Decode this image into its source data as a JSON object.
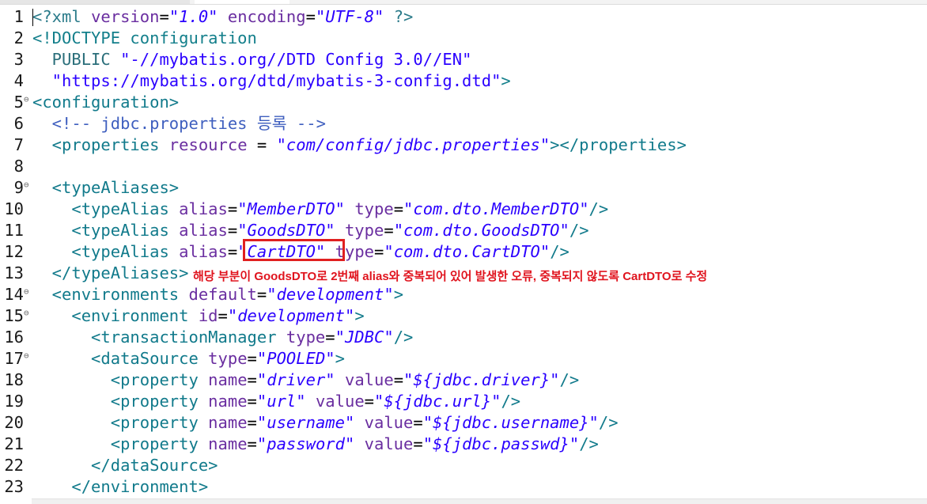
{
  "editor": {
    "lines": [
      {
        "num": "1",
        "fold": "",
        "segs": [
          [
            "pi",
            "<?xml "
          ],
          [
            "attr",
            "version"
          ],
          [
            "plain",
            "="
          ],
          [
            "str",
            "\"1.0\""
          ],
          [
            "plain",
            " "
          ],
          [
            "attr",
            "encoding"
          ],
          [
            "plain",
            "="
          ],
          [
            "str",
            "\"UTF-8\""
          ],
          [
            "plain",
            " "
          ],
          [
            "pi",
            "?>"
          ]
        ]
      },
      {
        "num": "2",
        "fold": "",
        "segs": [
          [
            "doct",
            "<!DOCTYPE configuration"
          ]
        ]
      },
      {
        "num": "3",
        "fold": "",
        "segs": [
          [
            "pub",
            "  PUBLIC "
          ],
          [
            "dstr",
            "\"-//mybatis.org//DTD Config 3.0//EN\""
          ]
        ]
      },
      {
        "num": "4",
        "fold": "",
        "segs": [
          [
            "dstr",
            "  \"https://mybatis.org/dtd/mybatis-3-config.dtd\""
          ],
          [
            "doct",
            ">"
          ]
        ]
      },
      {
        "num": "5",
        "fold": "⊖",
        "segs": [
          [
            "tag",
            "<configuration>"
          ]
        ]
      },
      {
        "num": "6",
        "fold": "",
        "segs": [
          [
            "comment",
            "  <!-- jdbc.properties 등록 -->"
          ]
        ]
      },
      {
        "num": "7",
        "fold": "",
        "segs": [
          [
            "tag",
            "  <properties "
          ],
          [
            "attr",
            "resource"
          ],
          [
            "plain",
            " = "
          ],
          [
            "str",
            "\"com/config/jdbc.properties\""
          ],
          [
            "tag",
            "></properties>"
          ]
        ]
      },
      {
        "num": "8",
        "fold": "",
        "segs": []
      },
      {
        "num": "9",
        "fold": "⊖",
        "segs": [
          [
            "tag",
            "  <typeAliases>"
          ]
        ]
      },
      {
        "num": "10",
        "fold": "",
        "segs": [
          [
            "tag",
            "    <typeAlias "
          ],
          [
            "attr",
            "alias"
          ],
          [
            "plain",
            "="
          ],
          [
            "str",
            "\"MemberDTO\""
          ],
          [
            "plain",
            " "
          ],
          [
            "attr",
            "type"
          ],
          [
            "plain",
            "="
          ],
          [
            "str",
            "\"com.dto.MemberDTO\""
          ],
          [
            "tag",
            "/>"
          ]
        ]
      },
      {
        "num": "11",
        "fold": "",
        "segs": [
          [
            "tag",
            "    <typeAlias "
          ],
          [
            "attr",
            "alias"
          ],
          [
            "plain",
            "="
          ],
          [
            "str",
            "\"GoodsDTO\""
          ],
          [
            "plain",
            " "
          ],
          [
            "attr",
            "type"
          ],
          [
            "plain",
            "="
          ],
          [
            "str",
            "\"com.dto.GoodsDTO\""
          ],
          [
            "tag",
            "/>"
          ]
        ]
      },
      {
        "num": "12",
        "fold": "",
        "segs": [
          [
            "tag",
            "    <typeAlias "
          ],
          [
            "attr",
            "alias"
          ],
          [
            "plain",
            "="
          ],
          [
            "str",
            "\"CartDTO\""
          ],
          [
            "plain",
            " "
          ],
          [
            "attr",
            "type"
          ],
          [
            "plain",
            "="
          ],
          [
            "str",
            "\"com.dto.CartDTO\""
          ],
          [
            "tag",
            "/>"
          ]
        ]
      },
      {
        "num": "13",
        "fold": "",
        "segs": [
          [
            "tag",
            "  </typeAliases>"
          ]
        ]
      },
      {
        "num": "14",
        "fold": "⊖",
        "segs": [
          [
            "tag",
            "  <environments "
          ],
          [
            "attr",
            "default"
          ],
          [
            "plain",
            "="
          ],
          [
            "str",
            "\"development\""
          ],
          [
            "tag",
            ">"
          ]
        ]
      },
      {
        "num": "15",
        "fold": "⊖",
        "segs": [
          [
            "tag",
            "    <environment "
          ],
          [
            "attr",
            "id"
          ],
          [
            "plain",
            "="
          ],
          [
            "str",
            "\"development\""
          ],
          [
            "tag",
            ">"
          ]
        ]
      },
      {
        "num": "16",
        "fold": "",
        "segs": [
          [
            "tag",
            "      <transactionManager "
          ],
          [
            "attr",
            "type"
          ],
          [
            "plain",
            "="
          ],
          [
            "str",
            "\"JDBC\""
          ],
          [
            "tag",
            "/>"
          ]
        ]
      },
      {
        "num": "17",
        "fold": "⊖",
        "segs": [
          [
            "tag",
            "      <dataSource "
          ],
          [
            "attr",
            "type"
          ],
          [
            "plain",
            "="
          ],
          [
            "str",
            "\"POOLED\""
          ],
          [
            "tag",
            ">"
          ]
        ]
      },
      {
        "num": "18",
        "fold": "",
        "segs": [
          [
            "tag",
            "        <property "
          ],
          [
            "attr",
            "name"
          ],
          [
            "plain",
            "="
          ],
          [
            "str",
            "\"driver\""
          ],
          [
            "plain",
            " "
          ],
          [
            "attr",
            "value"
          ],
          [
            "plain",
            "="
          ],
          [
            "str",
            "\"${jdbc.driver}\""
          ],
          [
            "tag",
            "/>"
          ]
        ]
      },
      {
        "num": "19",
        "fold": "",
        "segs": [
          [
            "tag",
            "        <property "
          ],
          [
            "attr",
            "name"
          ],
          [
            "plain",
            "="
          ],
          [
            "str",
            "\"url\""
          ],
          [
            "plain",
            " "
          ],
          [
            "attr",
            "value"
          ],
          [
            "plain",
            "="
          ],
          [
            "str",
            "\"${jdbc.url}\""
          ],
          [
            "tag",
            "/>"
          ]
        ]
      },
      {
        "num": "20",
        "fold": "",
        "segs": [
          [
            "tag",
            "        <property "
          ],
          [
            "attr",
            "name"
          ],
          [
            "plain",
            "="
          ],
          [
            "str",
            "\"username\""
          ],
          [
            "plain",
            " "
          ],
          [
            "attr",
            "value"
          ],
          [
            "plain",
            "="
          ],
          [
            "str",
            "\"${jdbc.username}\""
          ],
          [
            "tag",
            "/>"
          ]
        ]
      },
      {
        "num": "21",
        "fold": "",
        "segs": [
          [
            "tag",
            "        <property "
          ],
          [
            "attr",
            "name"
          ],
          [
            "plain",
            "="
          ],
          [
            "str",
            "\"password\""
          ],
          [
            "plain",
            " "
          ],
          [
            "attr",
            "value"
          ],
          [
            "plain",
            "="
          ],
          [
            "str",
            "\"${jdbc.passwd}\""
          ],
          [
            "tag",
            "/>"
          ]
        ]
      },
      {
        "num": "22",
        "fold": "",
        "segs": [
          [
            "tag",
            "      </dataSource>"
          ]
        ]
      },
      {
        "num": "23",
        "fold": "",
        "segs": [
          [
            "tag",
            "    </environment>"
          ]
        ]
      }
    ]
  },
  "annotation": {
    "note": "해당 부분이 GoodsDTO로 2번째 alias와 중복되어 있어 발생한 오류, 중복되지 않도록 CartDTO로 수정",
    "highlight_color": "#e02020"
  },
  "colors": {
    "tag": "#117a8b",
    "attr": "#6a2ea0",
    "string": "#2a00ff",
    "comment": "#3f5fbf"
  }
}
